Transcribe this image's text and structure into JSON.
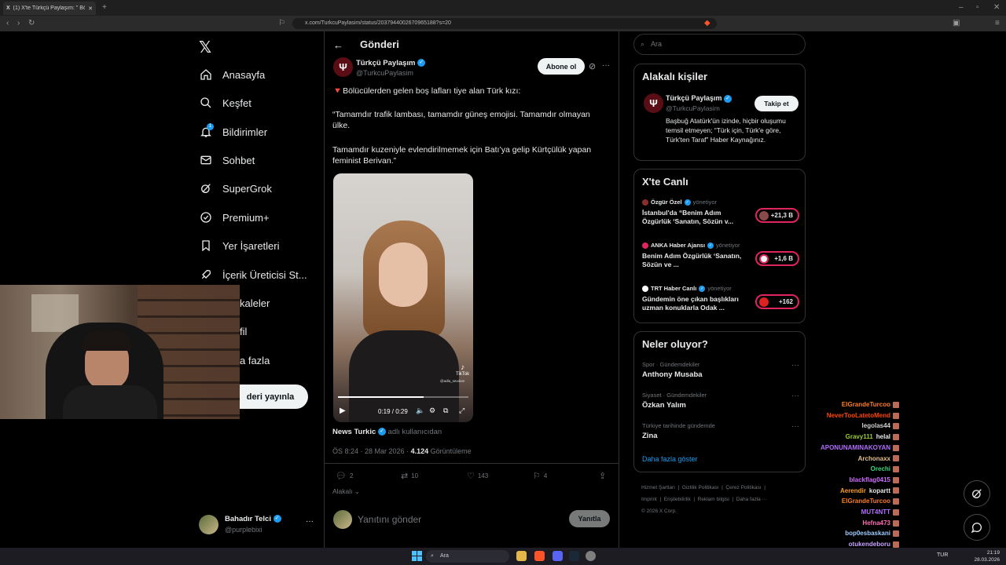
{
  "browser": {
    "tab_title": "(1) X'te Türkçü Paylaşım: \" Böl",
    "url": "x.com/TurkcuPaylasim/status/2037944002670965188?s=20"
  },
  "nav": {
    "items": [
      {
        "label": "Anasayfa",
        "icon": "home-icon"
      },
      {
        "label": "Keşfet",
        "icon": "search-icon"
      },
      {
        "label": "Bildirimler",
        "icon": "bell-icon"
      },
      {
        "label": "Sohbet",
        "icon": "mail-icon"
      },
      {
        "label": "SuperGrok",
        "icon": "grok-icon"
      },
      {
        "label": "Premium+",
        "icon": "premium-icon"
      },
      {
        "label": "Yer İşaretleri",
        "icon": "bookmark-icon"
      },
      {
        "label": "İçerik Üreticisi St...",
        "icon": "rocket-icon"
      },
      {
        "label": "kaleler",
        "icon": "article-icon"
      },
      {
        "label": "fil",
        "icon": "profile-icon"
      },
      {
        "label": "a fazla",
        "icon": "more-icon"
      }
    ],
    "notification_badge": "1",
    "post_button": "deri yayınla",
    "account": {
      "name": "Bahadır Telci",
      "handle": "@purplebixi"
    }
  },
  "header": {
    "title": "Gönderi"
  },
  "tweet": {
    "author": "Türkçü Paylaşım",
    "handle": "@TurkcuPaylasim",
    "subscribe": "Abone ol",
    "line1": "🔻Bölücülerden gelen boş lafları tiye alan Türk kızı:",
    "line2": "“Tamamdır trafik lambası, tamamdır güneş emojisi. Tamamdır olmayan ülke.",
    "line3": "Tamamdır kuzeniyle evlendirilmemek için Batı’ya gelip Kürtçülük yapan feminist Berivan.”",
    "video_time": "0:19 / 0:29",
    "video_progress": 0.655,
    "tiktok_label": "TikTok",
    "tiktok_user": "@adla_sevdam",
    "source_name": "News Turkic",
    "source_suffix": "adlı kullanıcıdan",
    "timestamp": "ÖS 8:24 · 28 Mar 2026 ·",
    "views_count": "4.124",
    "views_label": "Görüntüleme",
    "replies": "2",
    "reposts": "10",
    "likes": "143",
    "bookmarks": "4",
    "relevance": "Alakalı",
    "reply_placeholder": "Yanıtını gönder",
    "reply_button": "Yanıtla"
  },
  "search": {
    "placeholder": "Ara"
  },
  "related": {
    "title": "Alakalı kişiler",
    "name": "Türkçü Paylaşım",
    "handle": "@TurkcuPaylasim",
    "follow": "Takip et",
    "bio": "Başbuğ Atatürk'ün izinde, hiçbir oluşumu temsil etmeyen; “Türk için, Türk'e göre, Türk'ten Taraf” Haber Kaynağınız."
  },
  "live": {
    "title": "X'te Canlı",
    "items": [
      {
        "host": "Özgür Özel",
        "role": "yönetiyor",
        "title": "İstanbul'da “Benim Adım Özgürlük ‘Sanatın, Sözün v...",
        "count": "+21,3 B"
      },
      {
        "host": "ANKA Haber Ajansı",
        "role": "yönetiyor",
        "title": "Benim Adım Özgürlük ‘Sanatın, Sözün ve ...",
        "count": "+1,6 B"
      },
      {
        "host": "TRT Haber Canlı",
        "role": "yönetiyor",
        "title": "Gündemin öne çıkan başlıkları uzman konuklarla Odak ...",
        "count": "+162"
      }
    ]
  },
  "trends": {
    "title": "Neler oluyor?",
    "items": [
      {
        "category": "Spor · Gündemdekiler",
        "name": "Anthony Musaba"
      },
      {
        "category": "Siyaset · Gündemdekiler",
        "name": "Özkan Yalım"
      },
      {
        "category": "Türkiye tarihinde gündemde",
        "name": "Zina"
      }
    ],
    "show_more": "Daha fazla göster"
  },
  "footer": {
    "links": [
      "Hizmet Şartları",
      "Gizlilik Politikası",
      "Çerez Politikası",
      "Imprint",
      "Erişilebilirlik",
      "Reklam bilgisi",
      "Daha fazla ···"
    ],
    "copyright": "© 2026 X Corp."
  },
  "chat": [
    {
      "user": "ElGrandeTurcoo",
      "msg": "",
      "color": "#ff7f24"
    },
    {
      "user": "NeverTooLatetoMend",
      "msg": "",
      "color": "#ff4500"
    },
    {
      "user": "legolas44",
      "msg": "",
      "color": "#cfcfcf"
    },
    {
      "user": "Gravy111",
      "msg": "helal",
      "color": "#9acd32"
    },
    {
      "user": "APONUNAMINAKOYAN",
      "msg": "",
      "color": "#b26cff"
    },
    {
      "user": "Archonaxx",
      "msg": "",
      "color": "#e2c08d"
    },
    {
      "user": "Orechi",
      "msg": "",
      "color": "#3ad67a"
    },
    {
      "user": "blackflag0415",
      "msg": "",
      "color": "#d16bff"
    },
    {
      "user": "Aerendir",
      "msg": "kopartt",
      "color": "#ff9f1a"
    },
    {
      "user": "ElGrandeTurcoo",
      "msg": "",
      "color": "#ff7f24"
    },
    {
      "user": "MUT4NTT",
      "msg": "",
      "color": "#b26cff"
    },
    {
      "user": "Hefna473",
      "msg": "",
      "color": "#ff6eb4"
    },
    {
      "user": "bop0esbaskani",
      "msg": "",
      "color": "#9ecbff"
    },
    {
      "user": "otukendeboru",
      "msg": "",
      "color": "#c8a2ff"
    },
    {
      "user": "Orechi",
      "msg": "",
      "color": "#3ad67a"
    }
  ],
  "taskbar": {
    "search": "Ara",
    "lang": "TUR",
    "time": "21:19",
    "date": "28.03.2026"
  }
}
